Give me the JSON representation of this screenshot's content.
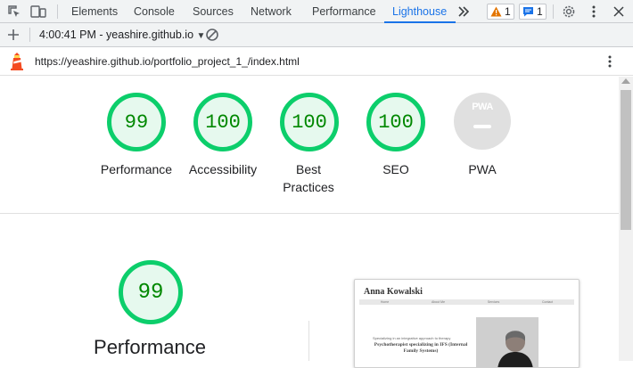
{
  "devtools": {
    "tabs": [
      {
        "label": "Elements"
      },
      {
        "label": "Console"
      },
      {
        "label": "Sources"
      },
      {
        "label": "Network"
      },
      {
        "label": "Performance"
      },
      {
        "label": "Lighthouse",
        "active": true
      }
    ],
    "more_tabs_icon": "double-chevron-right",
    "warnings_count": "1",
    "messages_count": "1",
    "accent_color": "#1a73e8"
  },
  "toolbar": {
    "report_label": "4:00:41 PM - yeashire.github.io"
  },
  "url": "https://yeashire.github.io/portfolio_project_1_/index.html",
  "scores": [
    {
      "value": "99",
      "label": "Performance"
    },
    {
      "value": "100",
      "label": "Accessibility"
    },
    {
      "value": "100",
      "label": "Best Practices"
    },
    {
      "value": "100",
      "label": "SEO"
    },
    {
      "value": "",
      "label": "PWA"
    }
  ],
  "score_color": "#0cce6b",
  "pwa_badge_text": "PWA",
  "performance_section": {
    "score": "99",
    "label": "Performance"
  },
  "screenshot": {
    "site_name": "Anna Kowalski",
    "nav": [
      "Home",
      "About Me",
      "Services",
      "Contact"
    ],
    "tagline": "Specializing in an integrative approach to therapy",
    "headline": "Psychotherapist specializing in IFS (Internal Family Systems)"
  }
}
